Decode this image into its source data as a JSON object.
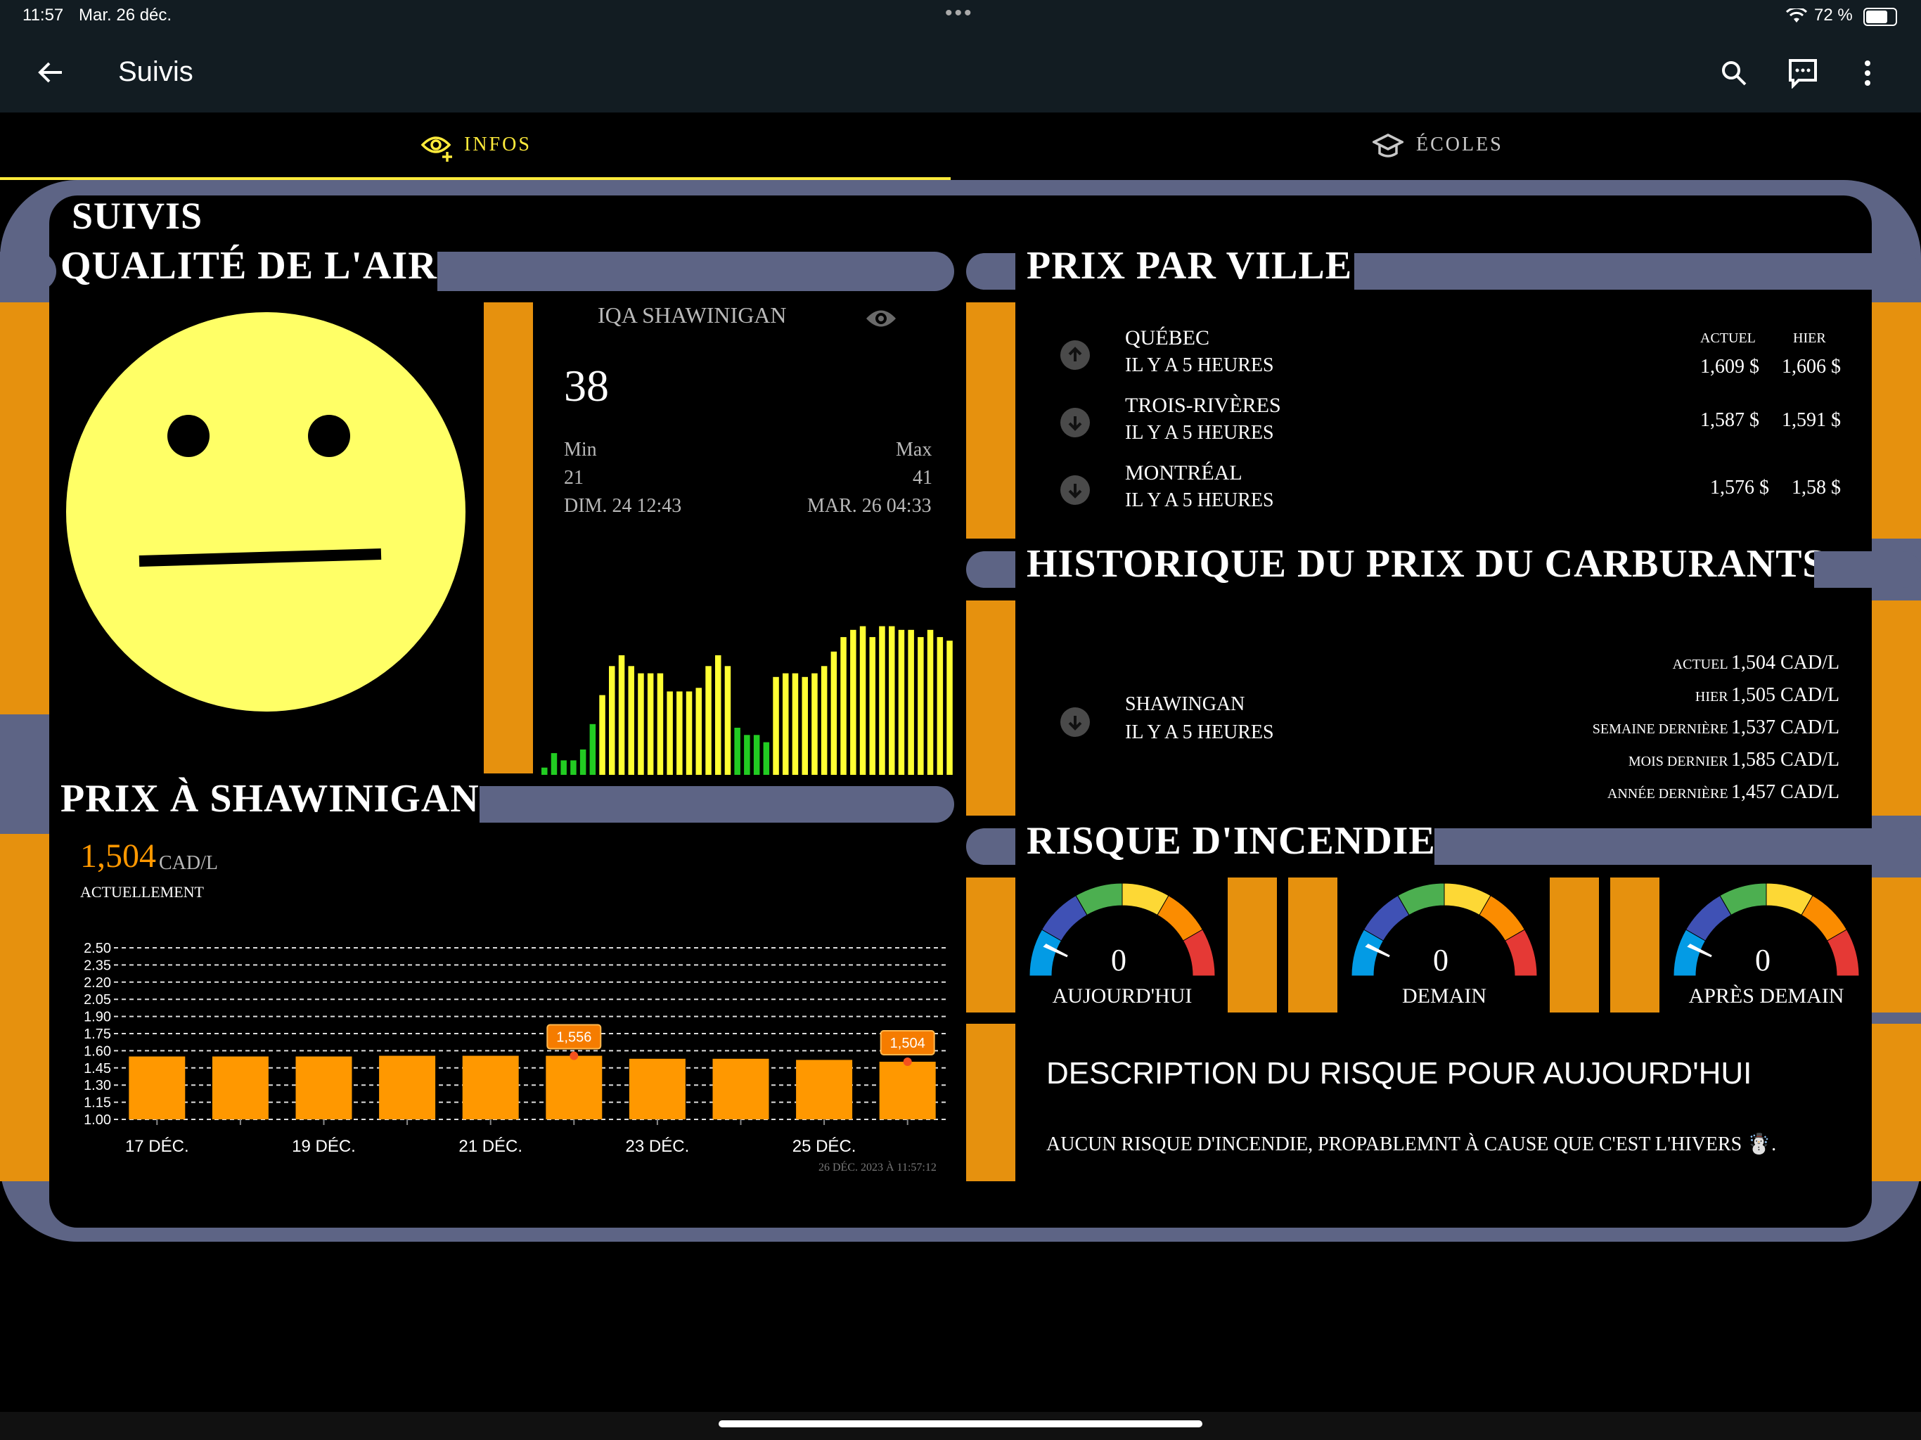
{
  "status": {
    "time": "11:57",
    "date": "Mar. 26 déc.",
    "battery": "72 %"
  },
  "appbar": {
    "title": "Suivis"
  },
  "tabs": [
    {
      "label": "INFOS",
      "active": true
    },
    {
      "label": "ÉCOLES",
      "active": false
    }
  ],
  "page": {
    "title": "SUIVIS"
  },
  "air": {
    "title": "QUALITÉ DE L'AIR",
    "card_title": "IQA SHAWINIGAN",
    "value": "38",
    "min_label": "Min",
    "max_label": "Max",
    "min_value": "21",
    "max_value": "41",
    "min_date": "DIM. 24 12:43",
    "max_date": "MAR. 26 04:33",
    "face_color": "#ffff66"
  },
  "price_city": {
    "title": "PRIX PAR VILLE",
    "col_actual": "ACTUEL",
    "col_yesterday": "HIER",
    "rows": [
      {
        "city": "QUÉBEC",
        "time": "IL Y A 5 HEURES",
        "actual": "1,609 $",
        "yesterday": "1,606 $",
        "trend": "up"
      },
      {
        "city": "TROIS-RIVÈRES",
        "time": "IL Y A 5 HEURES",
        "actual": "1,587 $",
        "yesterday": "1,591 $",
        "trend": "down"
      },
      {
        "city": "MONTRÉAL",
        "time": "IL Y A 5 HEURES",
        "actual": "1,576 $",
        "yesterday": "1,58 $",
        "trend": "down"
      }
    ]
  },
  "history": {
    "title": "HISTORIQUE DU PRIX DU CARBURANTS",
    "city": "SHAWINGAN",
    "time": "IL Y A 5 HEURES",
    "rows": [
      {
        "label": "ACTUEL",
        "value": "1,504 CAD/L"
      },
      {
        "label": "HIER",
        "value": "1,505 CAD/L"
      },
      {
        "label": "SEMAINE DERNIÈRE",
        "value": "1,537 CAD/L"
      },
      {
        "label": "MOIS DERNIER",
        "value": "1,585 CAD/L"
      },
      {
        "label": "ANNÉE DERNIÈRE",
        "value": "1,457 CAD/L"
      }
    ]
  },
  "shaw": {
    "title": "PRIX À SHAWINIGAN",
    "value": "1,504",
    "unit": "CAD/L",
    "caption": "ACTUELLEMENT",
    "timestamp": "26 DÉC. 2023 À 11:57:12"
  },
  "fire": {
    "title": "RISQUE D'INCENDIE",
    "gauges": [
      {
        "value": "0",
        "label": "AUJOURD'HUI"
      },
      {
        "value": "0",
        "label": "DEMAIN"
      },
      {
        "value": "0",
        "label": "APRÈS DEMAIN"
      }
    ],
    "desc_title": "DESCRIPTION DU RISQUE POUR AUJOURD'HUI",
    "desc_text": "AUCUN RISQUE D'INCENDIE, PROPABLEMNT À CAUSE QUE C'EST L'HIVERS ☃️."
  },
  "chart_data": [
    {
      "type": "bar",
      "title": "",
      "values": [
        2,
        6,
        4,
        4,
        7,
        14,
        22,
        30,
        33,
        30,
        28,
        28,
        28,
        23,
        23,
        23,
        24,
        30,
        33,
        30,
        13,
        11,
        11,
        9,
        27,
        28,
        28,
        27,
        28,
        30,
        34,
        38,
        40,
        41,
        38,
        41,
        41,
        40,
        40,
        38,
        40,
        38,
        37
      ],
      "colors_rule": "green when value < 15, yellow otherwise"
    },
    {
      "type": "bar",
      "categories": [
        "17 DÉC.",
        "18 DÉC.",
        "19 DÉC.",
        "20 DÉC.",
        "21 DÉC.",
        "22 DÉC.",
        "23 DÉC.",
        "24 DÉC.",
        "25 DÉC.",
        "26 DÉC."
      ],
      "x_tick_labels": [
        "17 DÉC.",
        "19 DÉC.",
        "21 DÉC.",
        "23 DÉC.",
        "25 DÉC."
      ],
      "values": [
        1.55,
        1.55,
        1.55,
        1.556,
        1.556,
        1.556,
        1.53,
        1.53,
        1.52,
        1.504
      ],
      "annotations": [
        {
          "index": 5,
          "label": "1,556"
        },
        {
          "index": 9,
          "label": "1,504"
        }
      ],
      "y_ticks": [
        "1.00",
        "1.15",
        "1.30",
        "1.45",
        "1.60",
        "1.75",
        "1.90",
        "2.05",
        "2.20",
        "2.35",
        "2.50"
      ],
      "ylim": [
        1.0,
        2.5
      ],
      "color": "#ff9800"
    }
  ]
}
